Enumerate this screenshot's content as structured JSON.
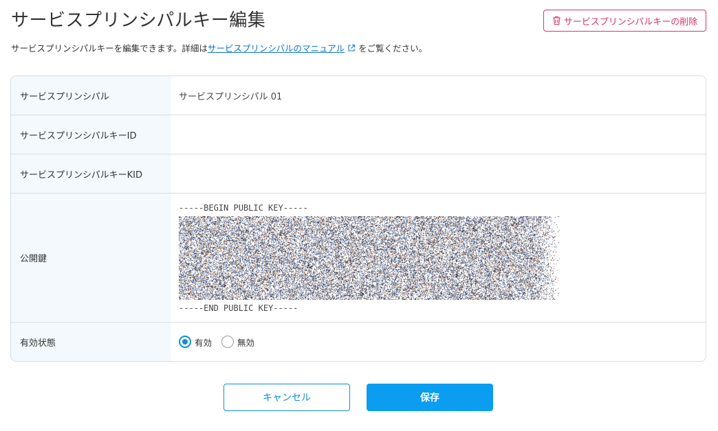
{
  "header": {
    "title": "サービスプリンシパルキー編集",
    "delete_label": "サービスプリンシパルキーの削除",
    "delete_icon": "trash-icon"
  },
  "description": {
    "prefix": "サービスプリンシパルキーを編集できます。詳細は",
    "link_text": "サービスプリンシパルのマニュアル",
    "link_icon": "external-link-icon",
    "suffix": "をご覧ください。"
  },
  "form": {
    "rows": [
      {
        "label": "サービスプリンシパル",
        "value": "サービスプリンシパル 01"
      },
      {
        "label": "サービスプリンシパルキーID",
        "value": ""
      },
      {
        "label": "サービスプリンシパルキーKID",
        "value": ""
      },
      {
        "label": "公開鍵",
        "key_begin": "-----BEGIN PUBLIC KEY-----",
        "key_end": "-----END PUBLIC KEY-----"
      },
      {
        "label": "有効状態",
        "options": [
          "有効",
          "無効"
        ],
        "selected": "有効"
      }
    ]
  },
  "actions": {
    "cancel_label": "キャンセル",
    "save_label": "保存"
  },
  "colors": {
    "accent": "#0a9df0",
    "danger": "#d6336c",
    "label_bg": "#f3f9fd"
  }
}
